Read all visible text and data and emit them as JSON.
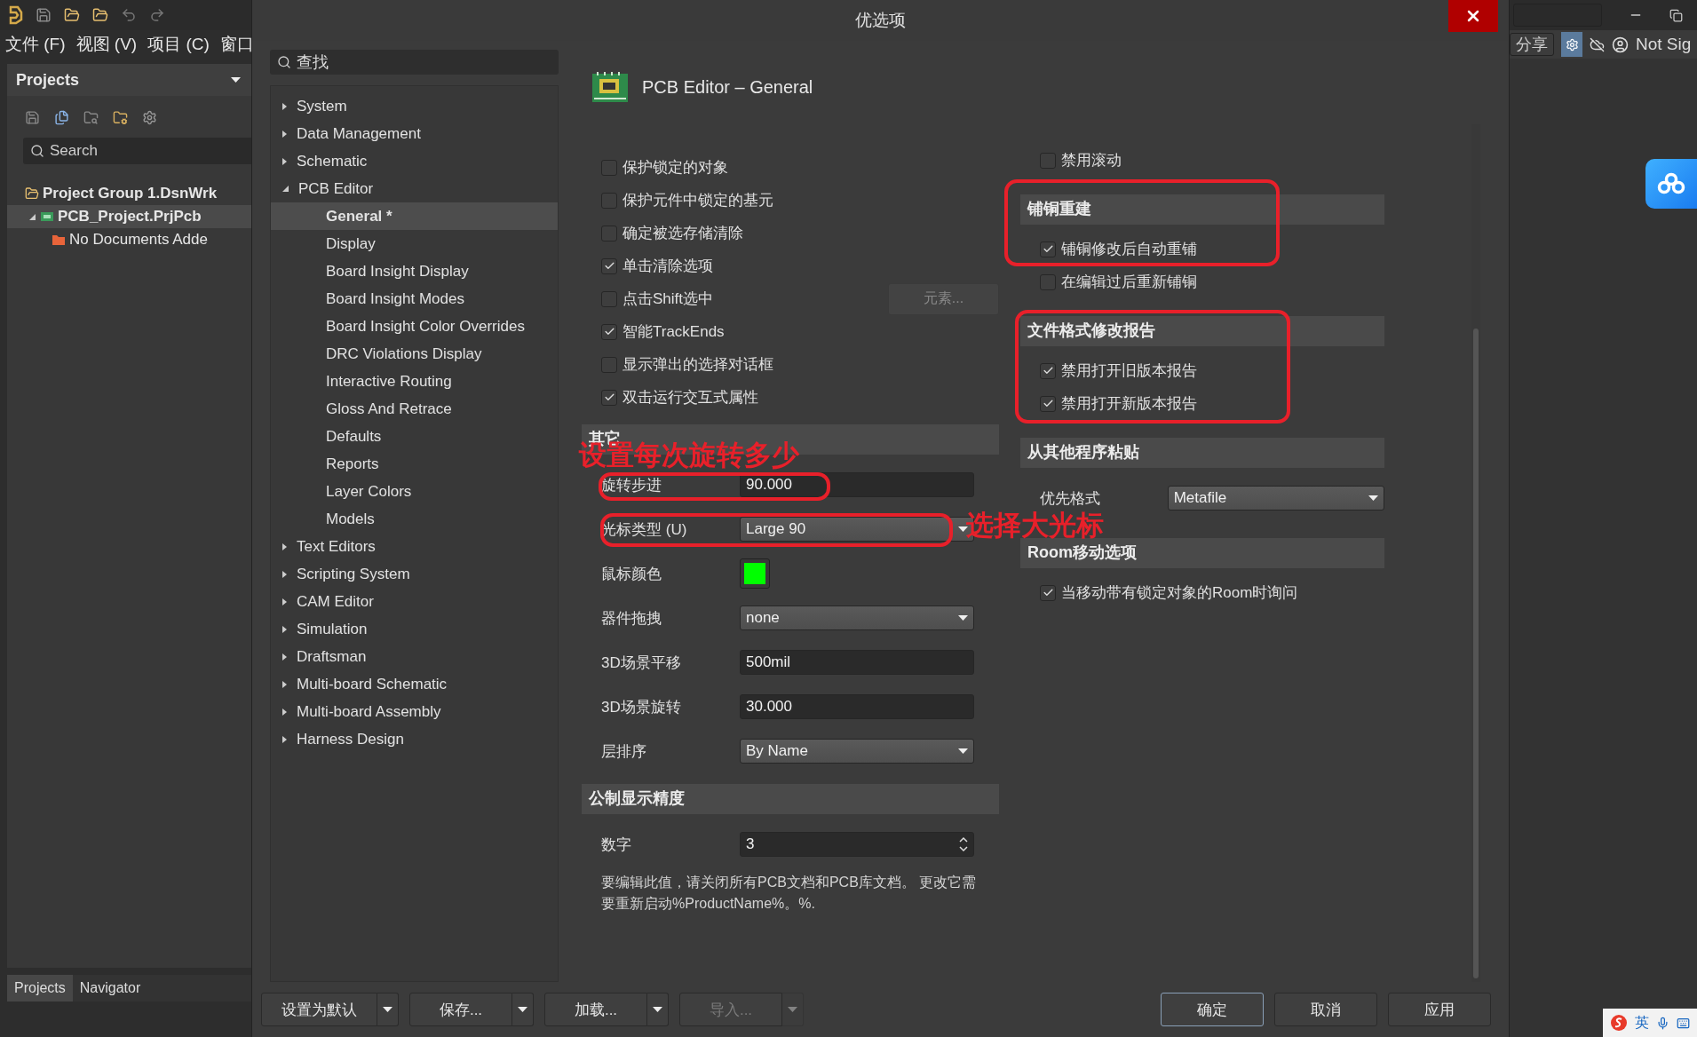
{
  "app": {
    "menu": [
      "文件 (F)",
      "视图 (V)",
      "项目 (C)",
      "窗口"
    ],
    "projects_panel": {
      "title": "Projects",
      "search": {
        "placeholder": "Search"
      },
      "tree": [
        {
          "label": "Project Group 1.DsnWrk",
          "selected": false,
          "children": [
            {
              "label": "PCB_Project.PrjPcb",
              "selected": true,
              "expanded": true,
              "children": [
                {
                  "label": "No Documents Adde"
                }
              ]
            }
          ]
        }
      ],
      "tabs": [
        {
          "label": "Projects",
          "selected": true
        },
        {
          "label": "Navigator",
          "selected": false
        }
      ]
    },
    "toolbar_right": {
      "share": "分享",
      "user": "Not Sig"
    },
    "ime": {
      "mode": "英"
    }
  },
  "dialog": {
    "title": "优选项",
    "search": {
      "placeholder": "查找"
    },
    "tree": [
      {
        "label": "System",
        "expanded": false
      },
      {
        "label": "Data Management",
        "expanded": false
      },
      {
        "label": "Schematic",
        "expanded": false
      },
      {
        "label": "PCB Editor",
        "expanded": true,
        "children": [
          {
            "label": "General *",
            "selected": true
          },
          {
            "label": "Display",
            "selected": false
          },
          {
            "label": "Board Insight Display",
            "selected": false
          },
          {
            "label": "Board Insight Modes",
            "selected": false
          },
          {
            "label": "Board Insight Color Overrides",
            "selected": false
          },
          {
            "label": "DRC Violations Display",
            "selected": false
          },
          {
            "label": "Interactive Routing",
            "selected": false
          },
          {
            "label": "Gloss And Retrace",
            "selected": false
          },
          {
            "label": "Defaults",
            "selected": false
          },
          {
            "label": "Reports",
            "selected": false
          },
          {
            "label": "Layer Colors",
            "selected": false
          },
          {
            "label": "Models",
            "selected": false
          }
        ]
      },
      {
        "label": "Text Editors",
        "expanded": false
      },
      {
        "label": "Scripting System",
        "expanded": false
      },
      {
        "label": "CAM Editor",
        "expanded": false
      },
      {
        "label": "Simulation",
        "expanded": false
      },
      {
        "label": "Draftsman",
        "expanded": false
      },
      {
        "label": "Multi-board Schematic",
        "expanded": false
      },
      {
        "label": "Multi-board Assembly",
        "expanded": false
      },
      {
        "label": "Harness Design",
        "expanded": false
      }
    ],
    "page_title": "PCB Editor – General",
    "left_column": [
      {
        "kind": "checkbox",
        "label": "保护锁定的对象",
        "checked": false
      },
      {
        "kind": "checkbox",
        "label": "保护元件中锁定的基元",
        "checked": false
      },
      {
        "kind": "checkbox",
        "label": "确定被选存储清除",
        "checked": false
      },
      {
        "kind": "checkbox",
        "label": "单击清除选项",
        "checked": true
      },
      {
        "kind": "checkbox",
        "label": "点击Shift选中",
        "checked": false,
        "button": {
          "label": "元素...",
          "disabled": true
        }
      },
      {
        "kind": "checkbox",
        "label": "智能TrackEnds",
        "checked": true
      },
      {
        "kind": "checkbox",
        "label": "显示弹出的选择对话框",
        "checked": false
      },
      {
        "kind": "checkbox",
        "label": "双击运行交互式属性",
        "checked": true
      },
      {
        "kind": "header",
        "label": "其它"
      },
      {
        "kind": "input",
        "label": "旋转步进",
        "value": "90.000"
      },
      {
        "kind": "dropdown",
        "label": "光标类型 (U)",
        "value": "Large 90"
      },
      {
        "kind": "color",
        "label": "鼠标颜色",
        "color": "#00ff00"
      },
      {
        "kind": "dropdown",
        "label": "器件拖拽",
        "value": "none"
      },
      {
        "kind": "input",
        "label": "3D场景平移",
        "value": "500mil"
      },
      {
        "kind": "input",
        "label": "3D场景旋转",
        "value": "30.000"
      },
      {
        "kind": "dropdown",
        "label": "层排序",
        "value": "By Name"
      },
      {
        "kind": "header",
        "label": "公制显示精度"
      },
      {
        "kind": "spin",
        "label": "数字",
        "value": "3"
      },
      {
        "kind": "note",
        "label": "要编辑此值，请关闭所有PCB文档和PCB库文档。 更改它需要重新启动%ProductName%。%."
      }
    ],
    "right_column": [
      {
        "kind": "checkbox",
        "label": "禁用滚动",
        "checked": false
      },
      {
        "kind": "header",
        "label": "铺铜重建"
      },
      {
        "kind": "checkbox",
        "label": "铺铜修改后自动重铺",
        "checked": true
      },
      {
        "kind": "checkbox",
        "label": "在编辑过后重新铺铜",
        "checked": false
      },
      {
        "kind": "header",
        "label": "文件格式修改报告"
      },
      {
        "kind": "checkbox",
        "label": "禁用打开旧版本报告",
        "checked": true
      },
      {
        "kind": "checkbox",
        "label": "禁用打开新版本报告",
        "checked": true
      },
      {
        "kind": "header",
        "label": "从其他程序粘贴"
      },
      {
        "kind": "dropdown",
        "label": "优先格式",
        "value": "Metafile"
      },
      {
        "kind": "header",
        "label": "Room移动选项"
      },
      {
        "kind": "checkbox",
        "label": "当移动带有锁定对象的Room时询问",
        "checked": true
      }
    ],
    "buttons": [
      {
        "label": "设置为默认",
        "split": true,
        "disabled": false,
        "default": false
      },
      {
        "label": "保存...",
        "split": true,
        "disabled": false,
        "default": false
      },
      {
        "label": "加载...",
        "split": true,
        "disabled": false,
        "default": false
      },
      {
        "label": "导入...",
        "split": true,
        "disabled": true,
        "default": false
      },
      {
        "label": "确定",
        "split": false,
        "disabled": false,
        "default": true
      },
      {
        "label": "取消",
        "split": false,
        "disabled": false,
        "default": false
      },
      {
        "label": "应用",
        "split": false,
        "disabled": false,
        "default": false
      }
    ]
  },
  "annotations": [
    {
      "text": "设置每次旋转多少"
    },
    {
      "text": "选择大光标"
    }
  ]
}
